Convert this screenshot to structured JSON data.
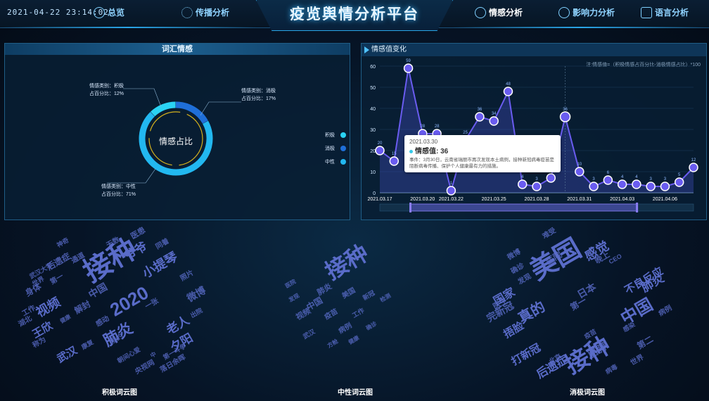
{
  "header": {
    "datetime": "2021-04-22 23:14:02",
    "title": "疫览舆情分析平台",
    "nav": [
      {
        "label": "总览",
        "icon": "gauge-icon"
      },
      {
        "label": "传播分析",
        "icon": "network-icon"
      },
      {
        "label": "情感分析",
        "icon": "heart-icon",
        "active": true
      },
      {
        "label": "影响力分析",
        "icon": "influence-icon"
      },
      {
        "label": "语言分析",
        "icon": "chat-icon"
      }
    ]
  },
  "vocab_panel": {
    "title": "词汇情感",
    "center_label": "情感占比",
    "slices": [
      {
        "type_label": "情感类别：积极",
        "pct_label": "占百分比：12%",
        "pct": 12,
        "color": "#2ad3f3"
      },
      {
        "type_label": "情感类别：消极",
        "pct_label": "占百分比：17%",
        "pct": 17,
        "color": "#1f6fd8"
      },
      {
        "type_label": "情感类别：中性",
        "pct_label": "占百分比：71%",
        "pct": 71,
        "color": "#22b8f0"
      }
    ],
    "legend": [
      {
        "label": "积极",
        "color": "#2ad3f3"
      },
      {
        "label": "消极",
        "color": "#1f6fd8"
      },
      {
        "label": "中性",
        "color": "#22b8f0"
      }
    ]
  },
  "trend_panel": {
    "title": "情感值变化",
    "formula": "注:情感值=（积极情感占百分比-消极情感占比）*100"
  },
  "chart_data": {
    "type": "line",
    "x": [
      "2021.03.17",
      "2021.03.18",
      "2021.03.19",
      "2021.03.20",
      "2021.03.21",
      "2021.03.22",
      "2021.03.23",
      "2021.03.24",
      "2021.03.25",
      "2021.03.26",
      "2021.03.27",
      "2021.03.28",
      "2021.03.29",
      "2021.03.30",
      "2021.03.31",
      "2021.04.01",
      "2021.04.02",
      "2021.04.03",
      "2021.04.04",
      "2021.04.05",
      "2021.04.06",
      "2021.04.07",
      "2021.04.08"
    ],
    "xticks": [
      "2021.03.17",
      "2021.03.20",
      "2021.03.22",
      "2021.03.25",
      "2021.03.28",
      "2021.03.31",
      "2021.04.03",
      "2021.04.06"
    ],
    "values": [
      20,
      15,
      59,
      28,
      28,
      1,
      25,
      36,
      34,
      48,
      4,
      3,
      7,
      36,
      10,
      3,
      6,
      4,
      4,
      3,
      3,
      5,
      12
    ],
    "ylim": [
      0,
      60
    ],
    "yticks": [
      0,
      10,
      20,
      30,
      40,
      50,
      60
    ],
    "line_color": "#6a5cf0",
    "point_color": "#6a5cf0"
  },
  "tooltip": {
    "date": "2021.03.30",
    "value_label": "情感值: 36",
    "event": "事件：3月30日，云南省瑞丽市再次发现本土病例，接种新冠病毒疫苗是阻断病毒传播、保护个人健康最有力的措施。"
  },
  "clouds": [
    {
      "title": "积极词云图",
      "words": [
        {
          "t": "接种",
          "s": 40
        },
        {
          "t": "2020",
          "s": 26
        },
        {
          "t": "肺炎",
          "s": 22
        },
        {
          "t": "视频",
          "s": 18
        },
        {
          "t": "小提琴",
          "s": 18
        },
        {
          "t": "爷爷",
          "s": 17
        },
        {
          "t": "老人",
          "s": 17
        },
        {
          "t": "夕阳",
          "s": 17
        },
        {
          "t": "王欣",
          "s": 15
        },
        {
          "t": "武汉",
          "s": 15
        },
        {
          "t": "微博",
          "s": 14
        },
        {
          "t": "中国",
          "s": 14
        },
        {
          "t": "后遗症",
          "s": 12
        },
        {
          "t": "身体",
          "s": 12
        },
        {
          "t": "解封",
          "s": 12
        },
        {
          "t": "医患",
          "s": 11
        },
        {
          "t": "无数",
          "s": 10
        },
        {
          "t": "同着",
          "s": 10
        },
        {
          "t": "照片",
          "s": 10
        },
        {
          "t": "工作",
          "s": 10
        },
        {
          "t": "湖北",
          "s": 10
        },
        {
          "t": "称为",
          "s": 10
        },
        {
          "t": "第一",
          "s": 10
        },
        {
          "t": "通道",
          "s": 10
        },
        {
          "t": "一张",
          "s": 10
        },
        {
          "t": "感动",
          "s": 10
        },
        {
          "t": "预约",
          "s": 10
        },
        {
          "t": "第一斗争",
          "s": 9
        },
        {
          "t": "朝间心爱",
          "s": 9
        },
        {
          "t": "央视网",
          "s": 10
        },
        {
          "t": "落日余晖",
          "s": 10
        },
        {
          "t": "出院",
          "s": 9
        },
        {
          "t": "康复",
          "s": 9
        },
        {
          "t": "神奇",
          "s": 9
        },
        {
          "t": "武汉大学",
          "s": 9
        },
        {
          "t": "世界",
          "s": 9
        },
        {
          "t": "健康",
          "s": 8
        },
        {
          "t": "中",
          "s": 8
        }
      ]
    },
    {
      "title": "中性词云图",
      "words": [
        {
          "t": "接种",
          "s": 32
        },
        {
          "t": "中国",
          "s": 12
        },
        {
          "t": "视频",
          "s": 11
        },
        {
          "t": "肺炎",
          "s": 11
        },
        {
          "t": "美国",
          "s": 10
        },
        {
          "t": "疫苗",
          "s": 10
        },
        {
          "t": "病例",
          "s": 10
        },
        {
          "t": "工作",
          "s": 9
        },
        {
          "t": "新冠",
          "s": 9
        },
        {
          "t": "武汉",
          "s": 9
        },
        {
          "t": "确诊",
          "s": 8
        },
        {
          "t": "医院",
          "s": 8
        },
        {
          "t": "健康",
          "s": 8
        },
        {
          "t": "检测",
          "s": 8
        },
        {
          "t": "发现",
          "s": 8
        },
        {
          "t": "方舱",
          "s": 8
        }
      ]
    },
    {
      "title": "消极词云图",
      "words": [
        {
          "t": "美国",
          "s": 38
        },
        {
          "t": "接种",
          "s": 34
        },
        {
          "t": "中国",
          "s": 24
        },
        {
          "t": "真的",
          "s": 20
        },
        {
          "t": "感觉",
          "s": 18
        },
        {
          "t": "肺炎",
          "s": 17
        },
        {
          "t": "后遗症",
          "s": 16
        },
        {
          "t": "国家",
          "s": 16
        },
        {
          "t": "捂脸",
          "s": 15
        },
        {
          "t": "打新冠",
          "s": 15
        },
        {
          "t": "不良反应",
          "s": 15
        },
        {
          "t": "完新冠",
          "s": 14
        },
        {
          "t": "日本",
          "s": 14
        },
        {
          "t": "胳膊",
          "s": 14
        },
        {
          "t": "医院",
          "s": 12
        },
        {
          "t": "第一",
          "s": 12
        },
        {
          "t": "医生",
          "s": 11
        },
        {
          "t": "晚上",
          "s": 11
        },
        {
          "t": "病例",
          "s": 10
        },
        {
          "t": "发现",
          "s": 10
        },
        {
          "t": "世界",
          "s": 10
        },
        {
          "t": "微博",
          "s": 10
        },
        {
          "t": "确诊",
          "s": 10
        },
        {
          "t": "难受",
          "s": 10
        },
        {
          "t": "病毒",
          "s": 9
        },
        {
          "t": "第二",
          "s": 12
        },
        {
          "t": "CEO",
          "s": 9
        },
        {
          "t": "北京",
          "s": 9
        },
        {
          "t": "感染",
          "s": 9
        },
        {
          "t": "疫苗",
          "s": 9
        }
      ]
    }
  ]
}
